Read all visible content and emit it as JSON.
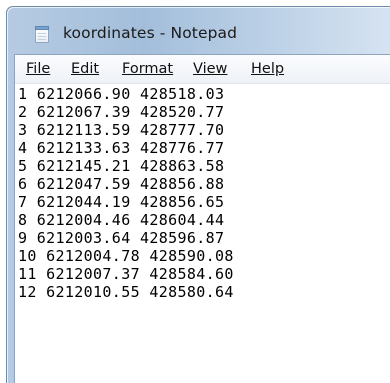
{
  "window": {
    "title": "koordinates - Notepad",
    "icon": "notepad-icon"
  },
  "menu": [
    "File",
    "Edit",
    "Format",
    "View",
    "Help"
  ],
  "document": {
    "lines": [
      "1 6212066.90 428518.03",
      "2 6212067.39 428520.77",
      "3 6212113.59 428777.70",
      "4 6212133.63 428776.77",
      "5 6212145.21 428863.58",
      "6 6212047.59 428856.88",
      "7 6212044.19 428856.65",
      "8 6212004.46 428604.44",
      "9 6212003.64 428596.87",
      "10 6212004.78 428590.08",
      "11 6212007.37 428584.60",
      "12 6212010.55 428580.64"
    ]
  }
}
